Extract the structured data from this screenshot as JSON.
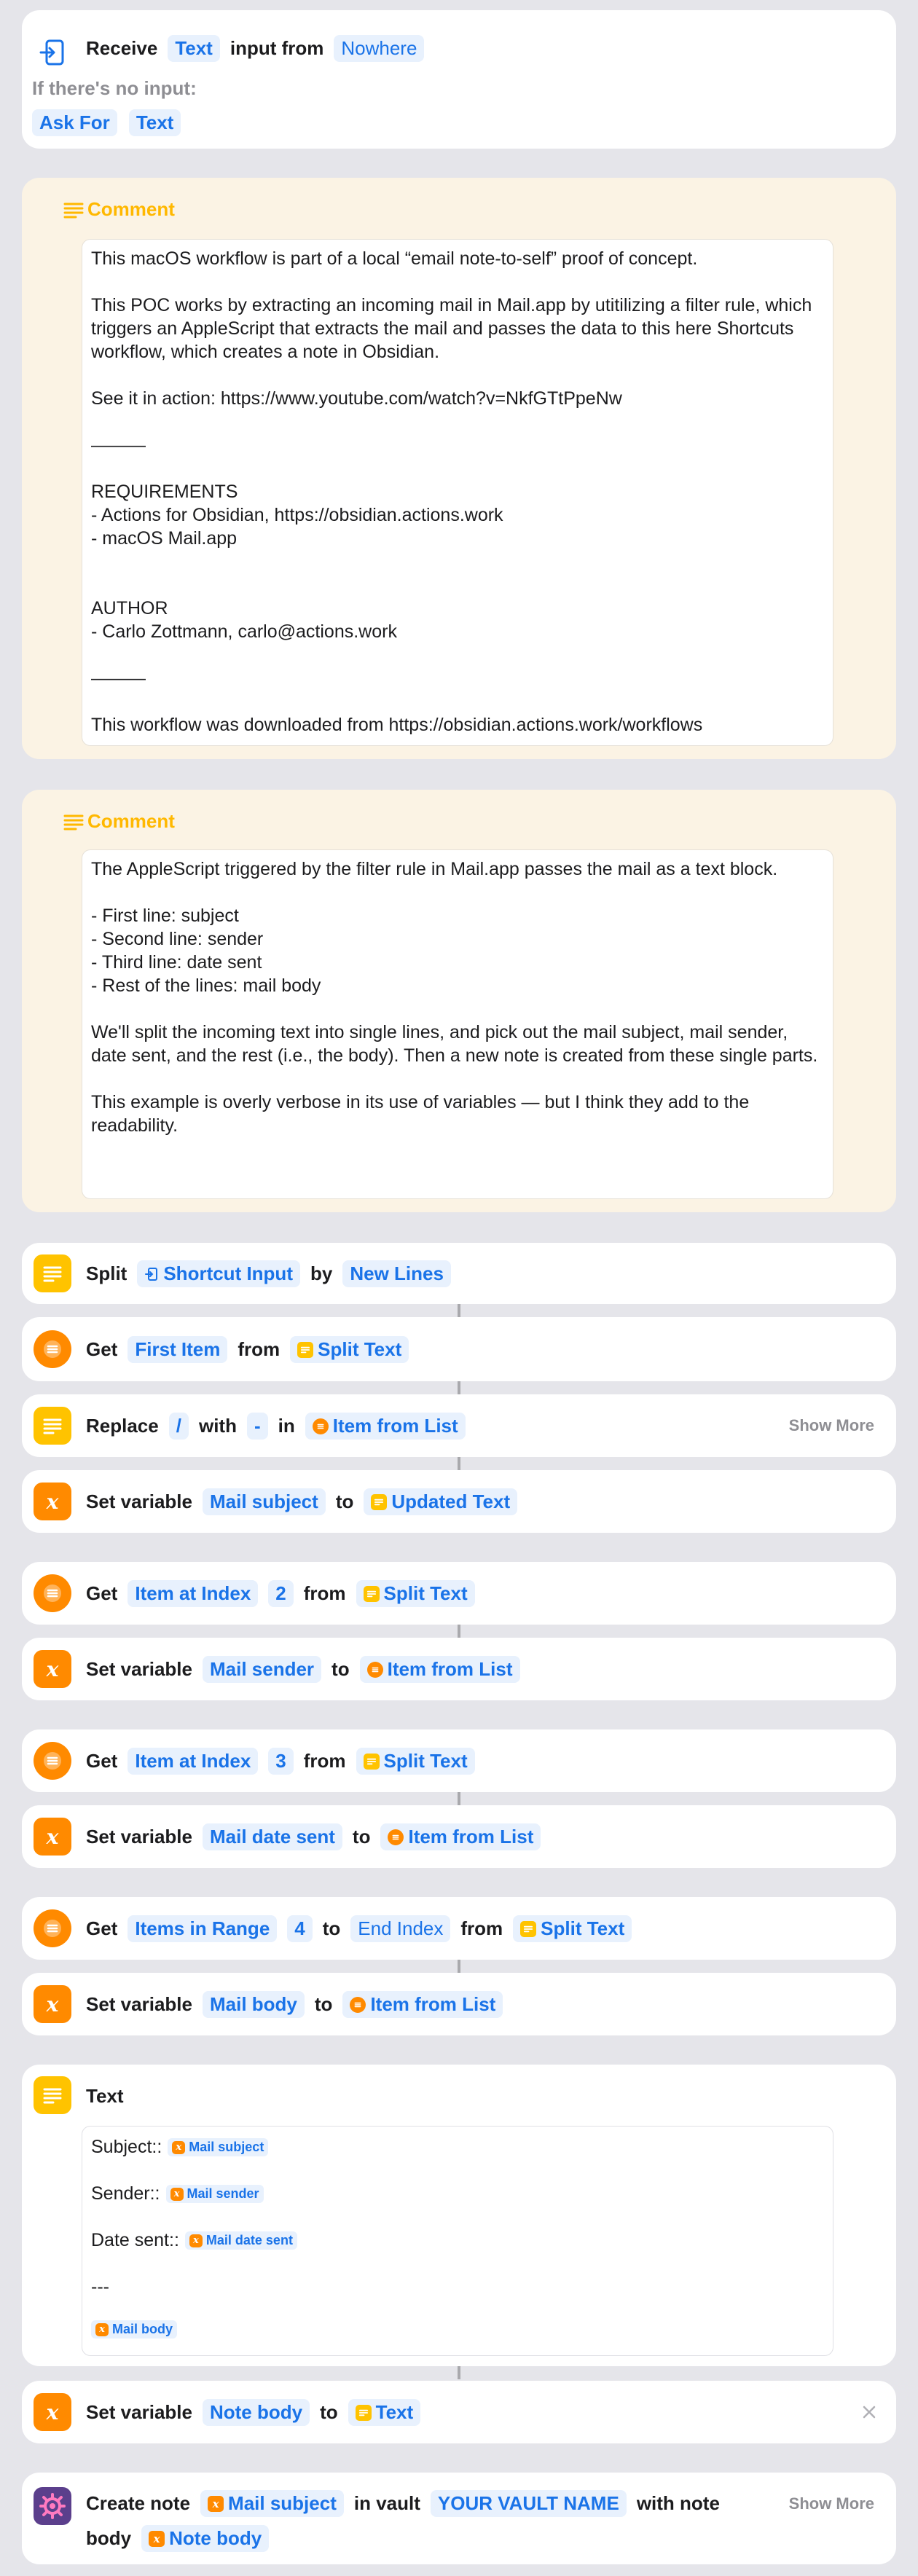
{
  "receive": {
    "label": "Receive",
    "type_token": "Text",
    "middle": "input from",
    "source_token": "Nowhere",
    "no_input_label": "If there's no input:",
    "ask_for": "Ask For",
    "ask_type": "Text"
  },
  "comment1": {
    "title": "Comment",
    "text": "This macOS workflow is part of a local “email note-to-self” proof of concept.\n\nThis POC works by extracting an incoming mail in Mail.app by utitilizing a filter rule, which triggers an AppleScript that extracts the mail and passes the data to this here Shortcuts workflow, which creates a note in Obsidian.\n\nSee it in action: https://www.youtube.com/watch?v=NkfGTtPpeNw\n\n———\n\nREQUIREMENTS\n- Actions for Obsidian, https://obsidian.actions.work\n- macOS Mail.app\n\n\nAUTHOR\n- Carlo Zottmann, carlo@actions.work\n\n———\n\nThis workflow was downloaded from https://obsidian.actions.work/workflows"
  },
  "comment2": {
    "title": "Comment",
    "text": "The AppleScript triggered by the filter rule in Mail.app passes the mail as a text block.\n\n- First line: subject\n- Second line: sender\n- Third line: date sent\n- Rest of the lines: mail body\n\nWe'll split the incoming text into single lines, and pick out the mail subject, mail sender, date sent, and the rest (i.e., the body). Then a new note is created from these single parts.\n\nThis example is overly verbose in its use of variables — but I think they add to the readability."
  },
  "split": {
    "label": "Split",
    "input": "Shortcut Input",
    "by": "by",
    "sep": "New Lines"
  },
  "get1": {
    "label": "Get",
    "what": "First Item",
    "from": "from",
    "src": "Split Text"
  },
  "replace": {
    "label": "Replace",
    "find": "/",
    "with": "with",
    "repl": "-",
    "in": "in",
    "src": "Item from List",
    "more": "Show More"
  },
  "set1": {
    "label": "Set variable",
    "var": "Mail subject",
    "to": "to",
    "val": "Updated Text"
  },
  "get2": {
    "label": "Get",
    "what": "Item at Index",
    "idx": "2",
    "from": "from",
    "src": "Split Text"
  },
  "set2": {
    "label": "Set variable",
    "var": "Mail sender",
    "to": "to",
    "val": "Item from List"
  },
  "get3": {
    "label": "Get",
    "what": "Item at Index",
    "idx": "3",
    "from": "from",
    "src": "Split Text"
  },
  "set3": {
    "label": "Set variable",
    "var": "Mail date sent",
    "to": "to",
    "val": "Item from List"
  },
  "get4": {
    "label": "Get",
    "what": "Items in Range",
    "start": "4",
    "to": "to",
    "end": "End Index",
    "from": "from",
    "src": "Split Text"
  },
  "set4": {
    "label": "Set variable",
    "var": "Mail body",
    "to": "to",
    "val": "Item from List"
  },
  "textblock": {
    "title": "Text",
    "subject_label": "Subject::",
    "subject_var": "Mail subject",
    "sender_label": "Sender::",
    "sender_var": "Mail sender",
    "date_label": "Date sent::",
    "date_var": "Mail date sent",
    "sep": "---",
    "body_var": "Mail body"
  },
  "set5": {
    "label": "Set variable",
    "var": "Note body",
    "to": "to",
    "val": "Text"
  },
  "create": {
    "label": "Create note",
    "var": "Mail subject",
    "in_vault": "in vault",
    "vault": "YOUR VAULT NAME",
    "with_note": "with note",
    "body": "body",
    "body_var": "Note body",
    "more": "Show More"
  },
  "colors": {
    "yellow": "#ffc300",
    "orange": "#ff8a00",
    "blue": "#1a73e8",
    "comment_bg": "#fbf3e4"
  }
}
